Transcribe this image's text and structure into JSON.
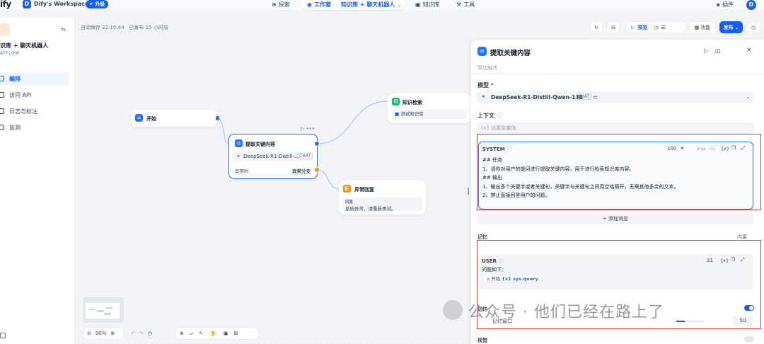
{
  "topbar": {
    "logo": "ify",
    "workspace_initial": "D",
    "workspace_name": "Dify's Workspace",
    "upgrade": "升级",
    "nav": {
      "explore": "探索",
      "studio": "工作室",
      "app": "知识库 + 聊天机器人",
      "knowledge": "知识库",
      "tools": "工具"
    },
    "plugins": "插件",
    "avatar": "D"
  },
  "sidebar": {
    "app_title": "识库 + 聊天机器人",
    "app_type": "ATFLOW",
    "items": [
      {
        "label": "编排"
      },
      {
        "label": "访问 API"
      },
      {
        "label": "日志与标注"
      },
      {
        "label": "监测"
      }
    ]
  },
  "canvas": {
    "autosave": "自动保存 22:10:44 · 已发布 15 小时前",
    "toolbar": {
      "preview": "预览",
      "features": "功能",
      "publish": "发布"
    },
    "nodes": {
      "start": {
        "title": "开始"
      },
      "extract": {
        "title": "提取关键内容",
        "model": "DeepSeek-R1-Distill-...",
        "badge": "CHAT",
        "fail": "异常时",
        "branch": "异常分支"
      },
      "knowledge": {
        "title": "知识检索",
        "dataset": "测试知识库"
      },
      "error": {
        "title": "异常回复",
        "label": "回复",
        "content": "系统异常，请重新再试。"
      }
    },
    "zoom": "90%"
  },
  "panel": {
    "title": "提取关键内容",
    "desc_placeholder": "添加描述...",
    "model_label": "模型",
    "model_name": "DeepSeek-R1-Distill-Qwen-14B",
    "model_badge": "CHAT",
    "context_label": "上下文",
    "context_placeholder": "设置变量值",
    "system": {
      "label": "SYSTEM",
      "count": "100",
      "jinja": "Jinja",
      "lines": [
        "## 任务",
        "1、请你对用户的提问进行提取关键内容，用于进行检索知识库内容。",
        "## 输出",
        "1、输出多个关键字或者关键句，关键字与关键句之间用空格隔开，无需其他多余的文本。",
        "2、禁止直接回答用户的问题。"
      ]
    },
    "add_message": "添加消息",
    "memory_label": "记忆",
    "builtin": "内置",
    "user": {
      "label": "USER",
      "count": "21",
      "line": "问题如下：",
      "var_node": "开始",
      "var_name": "sys.query"
    },
    "memory2": "记忆",
    "window_label": "记忆窗口",
    "window_value": "50",
    "vision_label": "视觉"
  },
  "watermark": "公众号 · 他们已经在路上了"
}
